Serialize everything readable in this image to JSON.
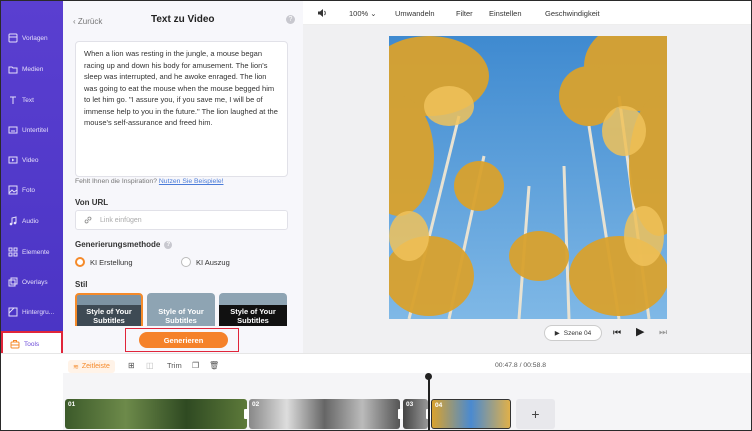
{
  "sidebar": {
    "items": [
      {
        "label": "Vorlagen",
        "icon": "template-icon"
      },
      {
        "label": "Medien",
        "icon": "folder-icon"
      },
      {
        "label": "Text",
        "icon": "text-icon"
      },
      {
        "label": "Untertitel",
        "icon": "subtitle-icon"
      },
      {
        "label": "Video",
        "icon": "video-icon"
      },
      {
        "label": "Foto",
        "icon": "photo-icon"
      },
      {
        "label": "Audio",
        "icon": "music-icon"
      },
      {
        "label": "Elemente",
        "icon": "elements-icon"
      },
      {
        "label": "Overlays",
        "icon": "overlays-icon"
      },
      {
        "label": "Hintergru...",
        "icon": "background-icon"
      },
      {
        "label": "Tools",
        "icon": "tools-icon",
        "active": true
      }
    ]
  },
  "panel": {
    "back_label": "Zurück",
    "title": "Text zu Video",
    "story_text": "When a lion was resting in the jungle, a mouse began racing up and down his body for amusement. The lion's sleep was interrupted, and he awoke enraged. The lion was going to eat the mouse when the mouse begged him to let him go. \"I assure you, if you save me, I will be of immense help to you in the future.\" The lion laughed at the mouse's self-assurance and freed him.",
    "inspiration_text": "Fehlt Ihnen die Inspiration?",
    "inspiration_link": "Nutzen Sie Beispiele!",
    "url_label": "Von URL",
    "url_placeholder": "Link einfügen",
    "method_label": "Generierungsmethode",
    "method_options": [
      "KI Erstellung",
      "KI Auszug"
    ],
    "method_selected": "KI Erstellung",
    "style_label": "Stil",
    "style_cards": [
      "Style of Your Subtitles",
      "Style of Your Subtitles",
      "Style of Your Subtitles"
    ],
    "generate_label": "Generieren"
  },
  "toolbar": {
    "zoom": "100%",
    "convert": "Umwandeln",
    "filter": "Filter",
    "settings": "Einstellen",
    "speed": "Geschwindigkeit"
  },
  "player": {
    "scene_label": "Szene 04"
  },
  "timeline": {
    "tab_label": "Zeitleiste",
    "trim_label": "Trim",
    "time_display": "00:47.8 / 00:58.8",
    "clips": [
      "01",
      "02",
      "03",
      "04"
    ]
  },
  "colors": {
    "sidebar": "#5a3fd0",
    "accent": "#f5822a",
    "highlight": "#e0253a"
  }
}
